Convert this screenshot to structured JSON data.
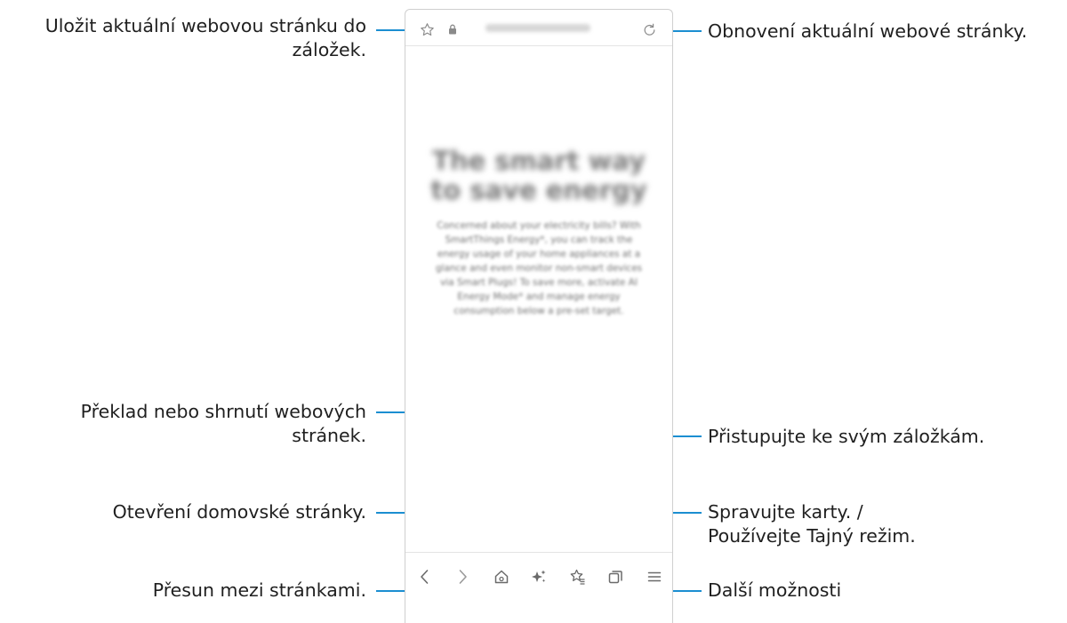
{
  "callouts": {
    "bookmark": [
      "Uložit aktuální webovou stránku do",
      "záložek."
    ],
    "refresh": "Obnovení aktuální webové stránky.",
    "translate": [
      "Překlad nebo shrnutí webových",
      "stránek."
    ],
    "bookmarks": "Přistupujte ke svým záložkám.",
    "home": "Otevření domovské stránky.",
    "tabs": [
      "Spravujte karty. /",
      "Používejte Tajný režim."
    ],
    "navigate": "Přesun mezi stránkami.",
    "more": "Další možnosti"
  },
  "page": {
    "title": "The smart way to save energy",
    "body": "Concerned about your electricity bills? With SmartThings Energy*, you can track the energy usage of your home appliances at a glance and even monitor non-smart devices via Smart Plugs! To save more, activate AI Energy Mode* and manage energy consumption below a pre-set target."
  },
  "colors": {
    "accent": "#1b8ed1"
  },
  "icons": [
    "star-icon",
    "lock-icon",
    "refresh-icon",
    "back-icon",
    "forward-icon",
    "home-icon",
    "sparkle-icon",
    "bookmarks-icon",
    "tabs-icon",
    "menu-icon"
  ]
}
